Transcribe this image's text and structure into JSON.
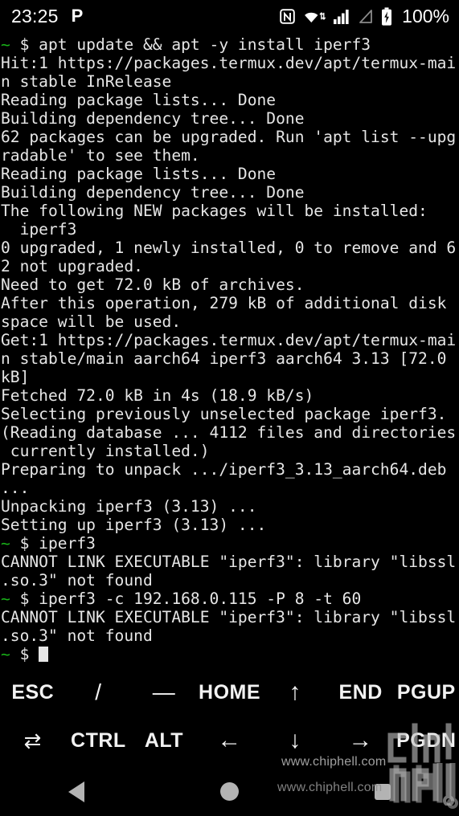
{
  "statusbar": {
    "time": "23:25",
    "app_indicator": "P",
    "battery_percent": "100%",
    "icons": [
      "nfc-icon",
      "wifi-icon",
      "signal-bars-icon",
      "signal-empty-icon",
      "battery-charging-icon"
    ]
  },
  "terminal": {
    "lines": [
      {
        "prompt": "~",
        "text": " $ apt update && apt -y install iperf3"
      },
      {
        "prompt": "",
        "text": "Hit:1 https://packages.termux.dev/apt/termux-mai"
      },
      {
        "prompt": "",
        "text": "n stable InRelease"
      },
      {
        "prompt": "",
        "text": "Reading package lists... Done"
      },
      {
        "prompt": "",
        "text": "Building dependency tree... Done"
      },
      {
        "prompt": "",
        "text": "62 packages can be upgraded. Run 'apt list --upg"
      },
      {
        "prompt": "",
        "text": "radable' to see them."
      },
      {
        "prompt": "",
        "text": "Reading package lists... Done"
      },
      {
        "prompt": "",
        "text": "Building dependency tree... Done"
      },
      {
        "prompt": "",
        "text": "The following NEW packages will be installed:"
      },
      {
        "prompt": "",
        "text": "  iperf3"
      },
      {
        "prompt": "",
        "text": "0 upgraded, 1 newly installed, 0 to remove and 6"
      },
      {
        "prompt": "",
        "text": "2 not upgraded."
      },
      {
        "prompt": "",
        "text": "Need to get 72.0 kB of archives."
      },
      {
        "prompt": "",
        "text": "After this operation, 279 kB of additional disk"
      },
      {
        "prompt": "",
        "text": "space will be used."
      },
      {
        "prompt": "",
        "text": "Get:1 https://packages.termux.dev/apt/termux-mai"
      },
      {
        "prompt": "",
        "text": "n stable/main aarch64 iperf3 aarch64 3.13 [72.0"
      },
      {
        "prompt": "",
        "text": "kB]"
      },
      {
        "prompt": "",
        "text": "Fetched 72.0 kB in 4s (18.9 kB/s)"
      },
      {
        "prompt": "",
        "text": "Selecting previously unselected package iperf3."
      },
      {
        "prompt": "",
        "text": "(Reading database ... 4112 files and directories"
      },
      {
        "prompt": "",
        "text": " currently installed.)"
      },
      {
        "prompt": "",
        "text": "Preparing to unpack .../iperf3_3.13_aarch64.deb"
      },
      {
        "prompt": "",
        "text": "..."
      },
      {
        "prompt": "",
        "text": "Unpacking iperf3 (3.13) ..."
      },
      {
        "prompt": "",
        "text": "Setting up iperf3 (3.13) ..."
      },
      {
        "prompt": "~",
        "text": " $ iperf3"
      },
      {
        "prompt": "",
        "text": "CANNOT LINK EXECUTABLE \"iperf3\": library \"libssl"
      },
      {
        "prompt": "",
        "text": ".so.3\" not found"
      },
      {
        "prompt": "~",
        "text": " $ iperf3 -c 192.168.0.115 -P 8 -t 60"
      },
      {
        "prompt": "",
        "text": "CANNOT LINK EXECUTABLE \"iperf3\": library \"libssl"
      },
      {
        "prompt": "",
        "text": ".so.3\" not found"
      },
      {
        "prompt": "~",
        "text": " $ ",
        "cursor": true
      }
    ],
    "prompt_color": "#18b218",
    "text_color": "#e6e6e6",
    "background": "#000000"
  },
  "extra_keys": {
    "row1": [
      {
        "label": "ESC",
        "name": "key-esc",
        "style": "txt"
      },
      {
        "label": "/",
        "name": "key-slash",
        "style": "sym"
      },
      {
        "label": "—",
        "name": "key-dash",
        "style": "sym"
      },
      {
        "label": "HOME",
        "name": "key-home",
        "style": "txt"
      },
      {
        "label": "↑",
        "name": "key-arrow-up",
        "style": "arrow"
      },
      {
        "label": "END",
        "name": "key-end",
        "style": "txt"
      },
      {
        "label": "PGUP",
        "name": "key-pgup",
        "style": "txt"
      }
    ],
    "row2": [
      {
        "label": "⇄",
        "name": "key-tab",
        "style": "tab"
      },
      {
        "label": "CTRL",
        "name": "key-ctrl",
        "style": "txt"
      },
      {
        "label": "ALT",
        "name": "key-alt",
        "style": "txt"
      },
      {
        "label": "←",
        "name": "key-arrow-left",
        "style": "arrow"
      },
      {
        "label": "↓",
        "name": "key-arrow-down",
        "style": "arrow"
      },
      {
        "label": "→",
        "name": "key-arrow-right",
        "style": "arrow"
      },
      {
        "label": "PGDN",
        "name": "key-pgdn",
        "style": "txt"
      }
    ]
  },
  "navbar": {
    "back": "back-button",
    "home": "home-button",
    "recents": "recents-button"
  },
  "watermark": {
    "url_top": "www.chiphell.com",
    "url_bottom": "www.chiphell.com",
    "logo_line1": "chip",
    "logo_line2": "hell"
  }
}
